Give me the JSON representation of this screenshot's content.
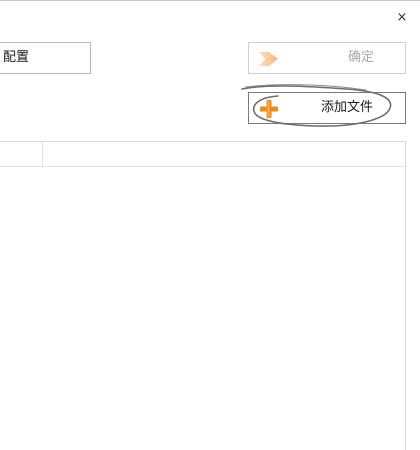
{
  "window": {
    "close_glyph": "×"
  },
  "toolbar": {
    "config_label": "配置",
    "ok_label": "确定",
    "ok_icon": "arrow-right-icon",
    "add_file_label": "添加文件",
    "add_file_icon": "plus-icon"
  },
  "file_table": {
    "columns": [
      "",
      ""
    ],
    "rows": []
  },
  "colors": {
    "icon_orange": "#f08a1c",
    "icon_orange_light": "#f7c28a",
    "disabled_text": "#a9a9a9",
    "scribble": "#6e6e6e"
  }
}
